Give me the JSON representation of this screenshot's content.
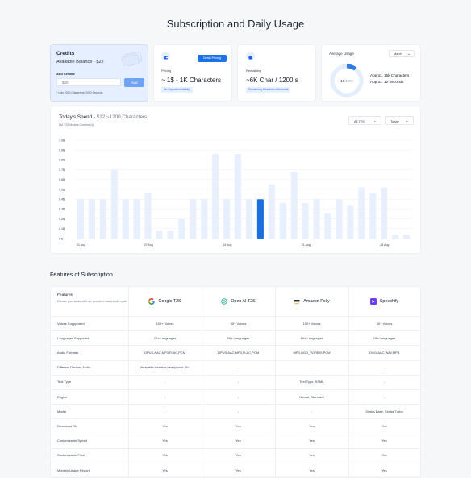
{
  "page_title": "Subscription and Daily Usage",
  "credits": {
    "title": "Credits",
    "balance": "Available Balance - $22",
    "add_label": "Add Credits",
    "input_placeholder": "$20",
    "add_button": "Add",
    "note": "* Upto 2000 Characters/ 2050 Seconds"
  },
  "pricing": {
    "detail_button": "Detail Pricing",
    "label": "Pricing",
    "value": "~ 1$ - 1K Characters",
    "badge": "No Expiration Validity"
  },
  "remaining": {
    "label": "Remaining",
    "value": "~6K Char / 1200 s",
    "badge": "Remaining Characters/Seconds"
  },
  "average_usage": {
    "title": "Average Usage",
    "period_select": "March",
    "donut_label_value": "10",
    "donut_label_total": "/100$",
    "percent": 0.1,
    "line1": "Approx. 15k Characters",
    "line2": "Approx. 12 Seconds",
    "colors": {
      "fill": "#2f7be6",
      "track": "#e3eefc"
    }
  },
  "today_spend": {
    "title_prefix": "Today's Spend - ",
    "title_value": "$12 ~1200 Characters",
    "subtitle": "(All T2S Models Combined)",
    "model_select": "All T2S",
    "range_select": "Today"
  },
  "chart_data": {
    "type": "bar",
    "yticks": [
      "0 $",
      "0.1$",
      "0.2$",
      "0.3$",
      "0.4$",
      "0.5$",
      "0.6$",
      "0.7$",
      "0.8$",
      "0.9$",
      "1.0$"
    ],
    "ylim": [
      0,
      1.0
    ],
    "x_tick_labels": [
      {
        "index": 0,
        "label": "01 Aug"
      },
      {
        "index": 6,
        "label": "07 Aug"
      },
      {
        "index": 13,
        "label": "14 Aug"
      },
      {
        "index": 20,
        "label": "21 Aug"
      },
      {
        "index": 27,
        "label": "28 Aug"
      }
    ],
    "values": [
      0.4,
      0.4,
      0.4,
      0.7,
      0.4,
      0.4,
      0.46,
      0.08,
      0.08,
      0.2,
      0.4,
      0.4,
      0.86,
      0.4,
      0.86,
      0.4,
      0.4,
      0.55,
      0.36,
      0.68,
      0.36,
      0.4,
      0.26,
      0.4,
      0.34,
      0.52,
      0.46,
      0.52,
      0.04,
      0.04
    ],
    "highlight_index": 16,
    "colors": {
      "bar": "#e8f0fd",
      "highlight": "#1d6fe0",
      "grid": "#f0f2f5"
    }
  },
  "features": {
    "title": "Features of Subscription",
    "header_title": "Features",
    "header_sub": "Elevate your audio with our premium subscription plan",
    "providers": [
      {
        "name": "Google T2S",
        "icon": "google-icon"
      },
      {
        "name": "Open AI T2S",
        "icon": "openai-icon"
      },
      {
        "name": "Amazon Polly",
        "icon": "aws-icon"
      },
      {
        "name": "Speechify",
        "icon": "speechify-icon"
      }
    ],
    "rows": [
      {
        "feature": "Voices Suppported",
        "values": [
          "100+ Voices",
          "50+ Voices",
          "150+ Voices",
          "50+ Voices"
        ]
      },
      {
        "feature": "Languages Supported",
        "values": [
          "70+ Languages",
          "50+ Languages",
          "90+ Languages",
          "70+ Languages"
        ]
      },
      {
        "feature": "Audio Formats",
        "values": [
          "OPUS,AAC,MP3,FLAC,PCM",
          "OPUS,AAC,MP3,FLAC,PCM",
          "MP3,OGG_VORBIS,PCM",
          "OGG,AAC,WAV,MP3"
        ]
      },
      {
        "feature": "Different Devices Audio",
        "values": [
          "Wearable,Headset,headphone,Etc.",
          "-",
          "-",
          "-"
        ]
      },
      {
        "feature": "Text Type",
        "values": [
          "-",
          "-",
          "Text Type, SSML",
          "-"
        ]
      },
      {
        "feature": "Engine",
        "values": [
          "-",
          "-",
          "Neural, Standard",
          "-"
        ]
      },
      {
        "feature": "Model",
        "values": [
          "-",
          "-",
          "-",
          "Simba Base, Simba Turbo"
        ]
      },
      {
        "feature": "Download File",
        "values": [
          "Yes",
          "Yes",
          "Yes",
          "Yes"
        ]
      },
      {
        "feature": "Customizable Speed",
        "values": [
          "Yes",
          "Yes",
          "Yes",
          "Yes"
        ]
      },
      {
        "feature": "Customizable Pitch",
        "values": [
          "Yes",
          "Yes",
          "Yes",
          "Yes"
        ]
      },
      {
        "feature": "Monthly Usage Report",
        "values": [
          "Yes",
          "Yes",
          "Yes",
          "Yes"
        ]
      }
    ]
  }
}
